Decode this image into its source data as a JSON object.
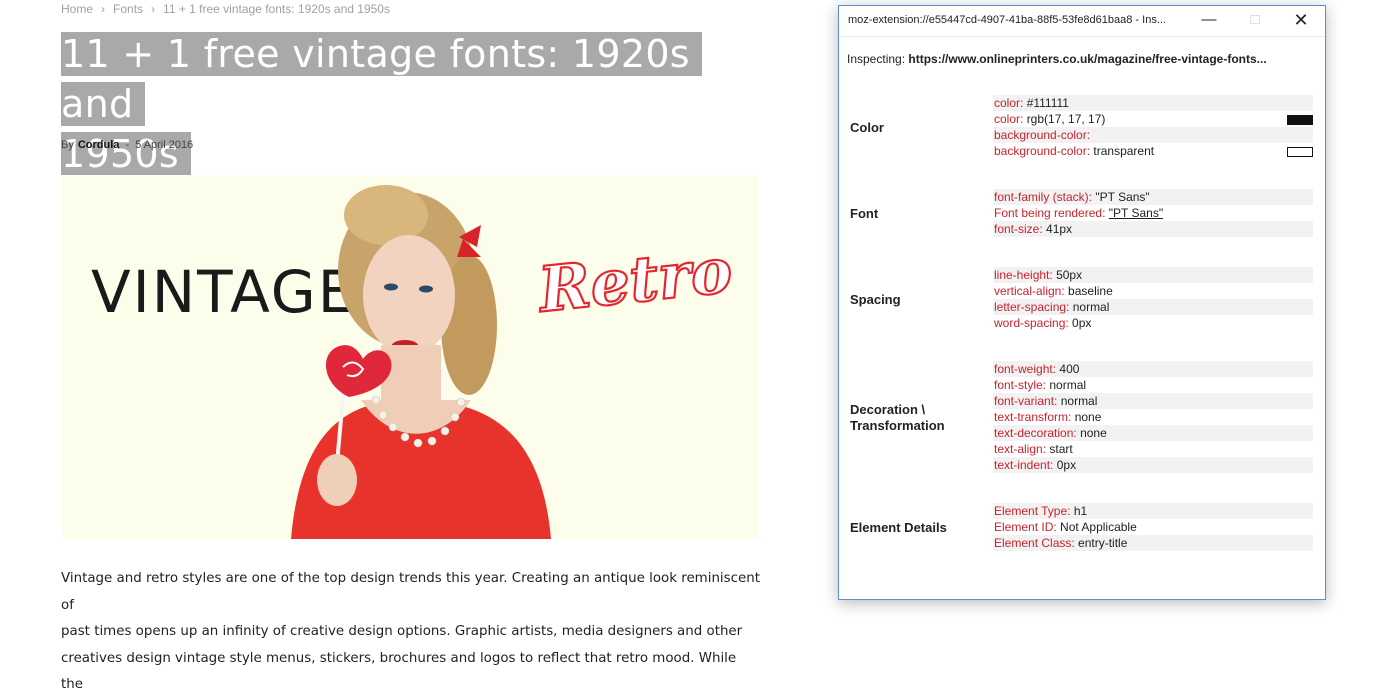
{
  "breadcrumb": {
    "home": "Home",
    "sep": "›",
    "category": "Fonts",
    "current": "11 + 1 free vintage fonts: 1920s and 1950s"
  },
  "article": {
    "title_line1": "11 + 1 free vintage fonts: 1920s and",
    "title_line2": "1950s",
    "by": "By",
    "author": "Cordula",
    "dash": "-",
    "date": "5 April 2016",
    "hero": {
      "word_left": "VINTAGE",
      "word_right": "Retro"
    },
    "body_lines": [
      "Vintage and retro styles are one of the top design trends this year. Creating an antique look reminiscent of",
      "past times opens up an infinity of creative design options. Graphic artists, media designers and other",
      "creatives design vintage style menus, stickers, brochures and logos to reflect that retro mood. While the"
    ]
  },
  "inspector": {
    "window_title": "moz-extension://e55447cd-4907-41ba-88f5-53fe8d61baa8 - Ins...",
    "inspecting_label": "Inspecting:",
    "inspecting_url": "https://www.onlineprinters.co.uk/magazine/free-vintage-fonts...",
    "sections": {
      "color": {
        "label": "Color",
        "props": [
          {
            "k": "color:",
            "v": "#111111"
          },
          {
            "k": "color:",
            "v": "rgb(17, 17, 17)"
          },
          {
            "k": "background-color:",
            "v": ""
          },
          {
            "k": "background-color:",
            "v": "transparent"
          }
        ],
        "swatch_colors": [
          "#111111",
          "transparent"
        ]
      },
      "font": {
        "label": "Font",
        "props": [
          {
            "k": "font-family (stack):",
            "v": "\"PT Sans\""
          },
          {
            "k": "Font being rendered:",
            "v": "\"PT Sans\""
          },
          {
            "k": "font-size:",
            "v": "41px"
          }
        ]
      },
      "spacing": {
        "label": "Spacing",
        "props": [
          {
            "k": "line-height:",
            "v": "50px"
          },
          {
            "k": "vertical-align:",
            "v": "baseline"
          },
          {
            "k": "letter-spacing:",
            "v": "normal"
          },
          {
            "k": "word-spacing:",
            "v": "0px"
          }
        ]
      },
      "decoration": {
        "label_line1": "Decoration \\",
        "label_line2": "Transformation",
        "props": [
          {
            "k": "font-weight:",
            "v": "400"
          },
          {
            "k": "font-style:",
            "v": "normal"
          },
          {
            "k": "font-variant:",
            "v": "normal"
          },
          {
            "k": "text-transform:",
            "v": "none"
          },
          {
            "k": "text-decoration:",
            "v": "none"
          },
          {
            "k": "text-align:",
            "v": "start"
          },
          {
            "k": "text-indent:",
            "v": "0px"
          }
        ]
      },
      "element": {
        "label": "Element Details",
        "props": [
          {
            "k": "Element Type:",
            "v": "h1"
          },
          {
            "k": "Element ID:",
            "v": "Not Applicable"
          },
          {
            "k": "Element Class:",
            "v": "entry-title"
          }
        ]
      }
    },
    "colors": {
      "key": "#c8232c",
      "border": "#5a8fd0",
      "title_highlight": "#a9a9a9"
    }
  }
}
